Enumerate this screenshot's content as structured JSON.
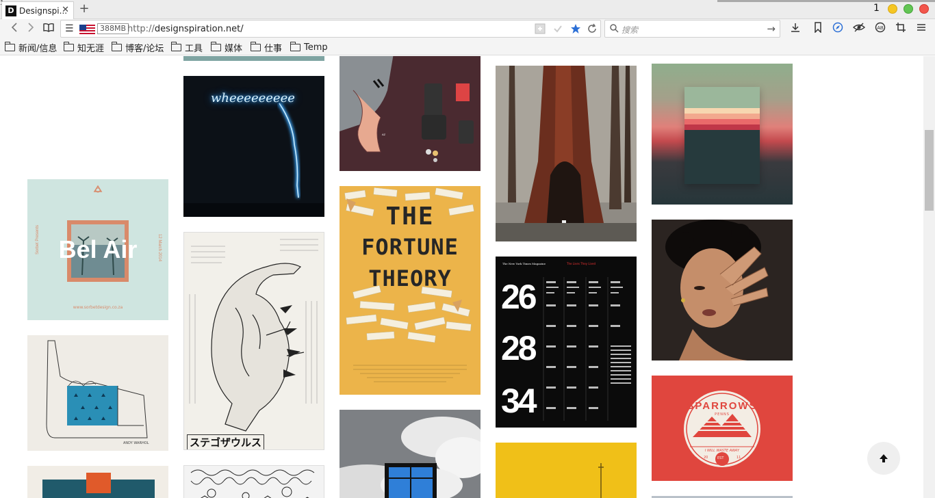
{
  "window": {
    "tab_title": "Designspi...",
    "tab_favicon": "D",
    "tab_close": "✕",
    "new_tab": "+",
    "window_count": "1",
    "corner_mark": "1"
  },
  "toolbar": {
    "reader_icon": "☰",
    "memory": "388MB",
    "url_scheme": "http://",
    "url_host": "designspiration.net/",
    "search_placeholder": "搜索",
    "go_icon": "→"
  },
  "bookmarks": [
    {
      "label": "新闻/信息"
    },
    {
      "label": "知无涯"
    },
    {
      "label": "博客/论坛"
    },
    {
      "label": "工具"
    },
    {
      "label": "媒体"
    },
    {
      "label": "仕事"
    },
    {
      "label": "Temp"
    }
  ],
  "cards": {
    "bel_air": {
      "title": "Bel Air",
      "url": "www.sorbetdesign.co.za"
    },
    "neon": {
      "text": "wheeeeeeeee"
    },
    "fortune": {
      "line1": "THE",
      "line2": "FORTUNE",
      "line3": "THEORY"
    },
    "godzilla": {
      "caption": "ステゴザウルス"
    },
    "magazine": {
      "header": "The New York Times Magazine",
      "subhead": "The Lives They Lived",
      "n1": "26",
      "n2": "28",
      "n3": "34"
    },
    "sparrows": {
      "title": "SPARROWS",
      "sub": "PENNS",
      "motto": "I WILL WASTE AWAY",
      "year_left": "20",
      "year_right": "11",
      "badge": "EST"
    },
    "warhol": {
      "signature": "ANDY WARHOL"
    }
  },
  "colors": {
    "bel_air_bg": "#cfe5e0",
    "sparrows_red": "#e0463e",
    "magazine_black": "#0b0b0b",
    "fortune_yellow": "#ecb44a"
  },
  "scroll_top_icon": "🠕"
}
